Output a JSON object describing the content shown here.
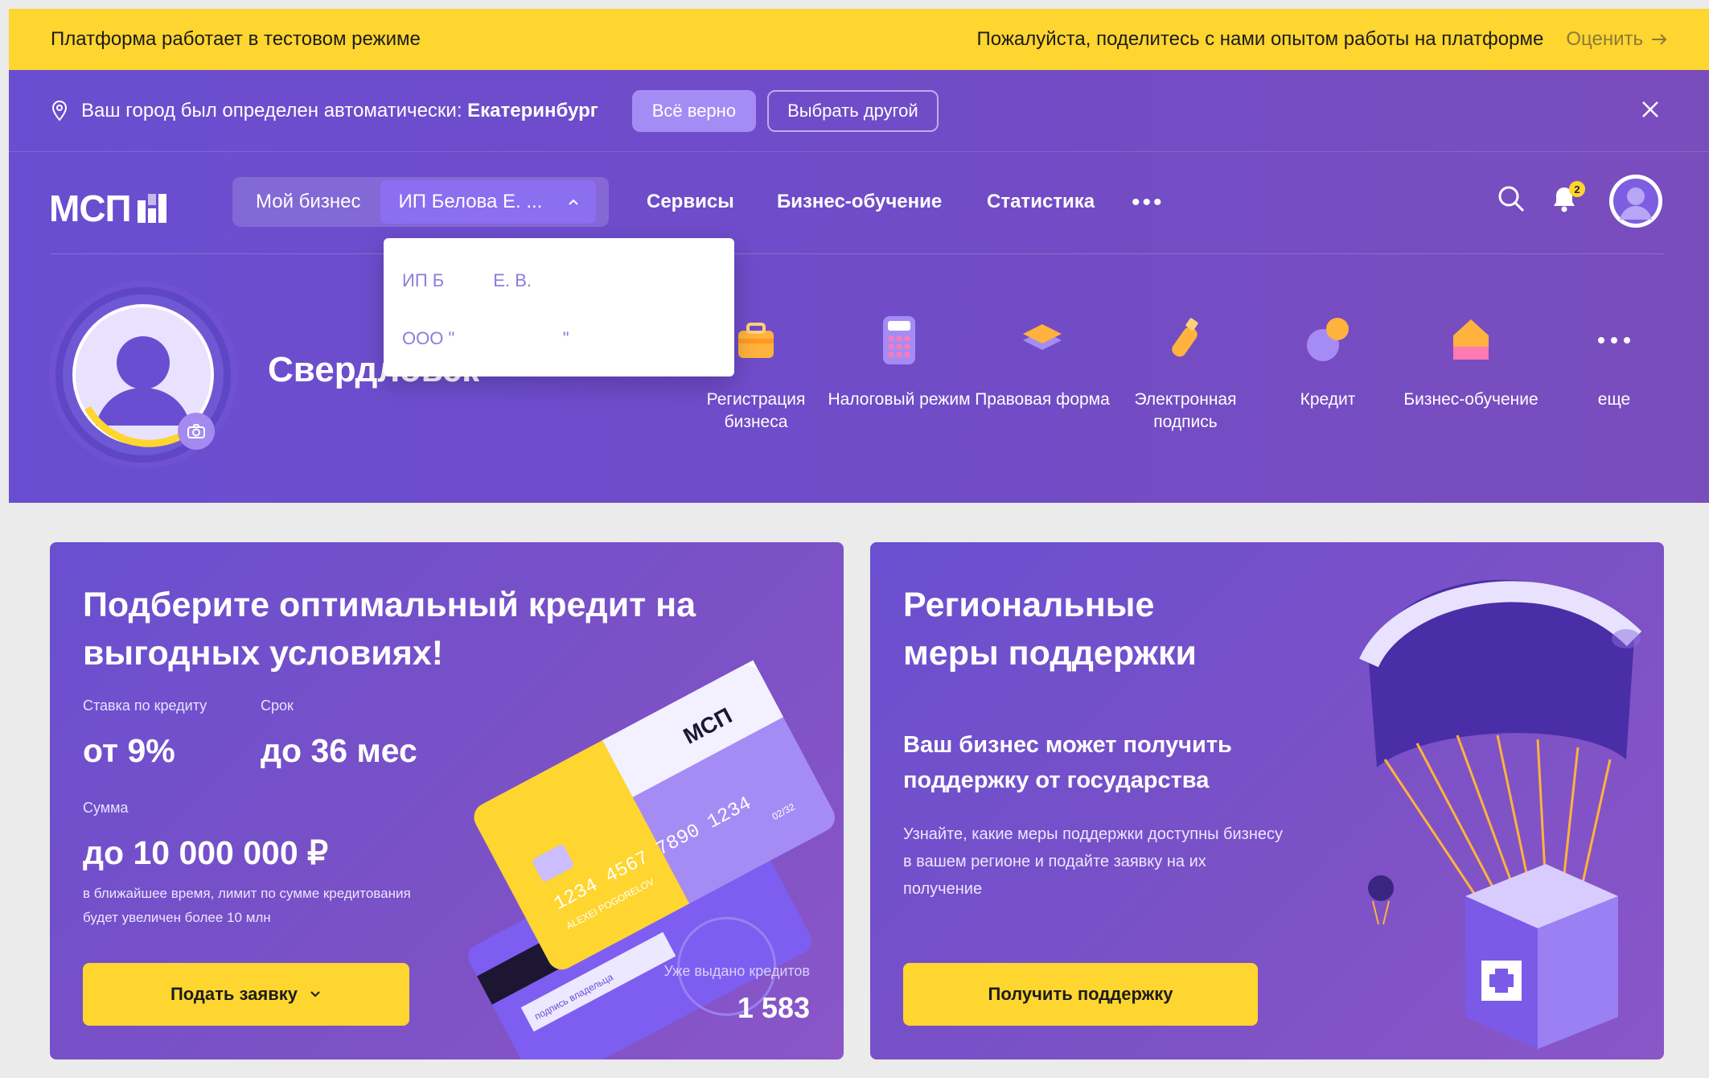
{
  "test_banner": {
    "left_text": "Платформа работает в тестовом режиме",
    "right_text": "Пожалуйста, поделитесь с нами опытом работы на платформе",
    "rate_label": "Оценить"
  },
  "city_bar": {
    "text": "Ваш город был определен автоматически:",
    "city": "Екатеринбург",
    "confirm_label": "Всё верно",
    "other_label": "Выбрать другой"
  },
  "nav": {
    "logo_text": "МСП",
    "my_business_label": "Мой бизнес",
    "business_selected": "ИП Белова Е. ...",
    "links": [
      "Сервисы",
      "Бизнес-обучение",
      "Статистика"
    ],
    "more": "•••",
    "notification_count": "2"
  },
  "dropdown": {
    "items": [
      "ИП Б          Е. В.",
      "ООО \"                      \""
    ]
  },
  "profile": {
    "region_name": "Свердловск"
  },
  "services": [
    {
      "label": "Регистрация бизнеса",
      "icon": "briefcase-icon"
    },
    {
      "label": "Налоговый режим",
      "icon": "calculator-icon"
    },
    {
      "label": "Правовая форма",
      "icon": "layers-icon"
    },
    {
      "label": "Электронная подпись",
      "icon": "usb-key-icon"
    },
    {
      "label": "Кредит",
      "icon": "coins-icon"
    },
    {
      "label": "Бизнес-обучение",
      "icon": "school-icon"
    },
    {
      "label": "еще",
      "icon": "more-icon"
    }
  ],
  "credit_card": {
    "title_line1": "Подберите оптимальный кредит на",
    "title_line2": "выгодных условиях!",
    "rate_label": "Ставка по кредиту",
    "rate_value": "от 9%",
    "term_label": "Срок",
    "term_value": "до 36 мес",
    "sum_label": "Сумма",
    "sum_value": "до 10 000 000 ₽",
    "note": "в ближайшее время, лимит по сумме кредитования будет увеличен более 10 млн",
    "apply_label": "Подать заявку",
    "issued_label": "Уже выдано кредитов",
    "issued_value": "1 583",
    "card_logo": "МСП",
    "card_number": "1234 4567 7890 1234",
    "card_name": "ALEXEI POGORELOV",
    "card_exp": "02/32",
    "card_sig": "подпись владельца"
  },
  "support_card": {
    "title_line1": "Региональные",
    "title_line2": "меры поддержки",
    "subtitle": "Ваш бизнес может получить поддержку от государства",
    "description": "Узнайте, какие меры поддержки доступны бизнесу в вашем регионе и подайте заявку на их получение",
    "button_label": "Получить поддержку"
  },
  "colors": {
    "accent_yellow": "#ffd52f",
    "hero_purple": "#6a4ed1",
    "button_purple": "#a58cf5"
  }
}
